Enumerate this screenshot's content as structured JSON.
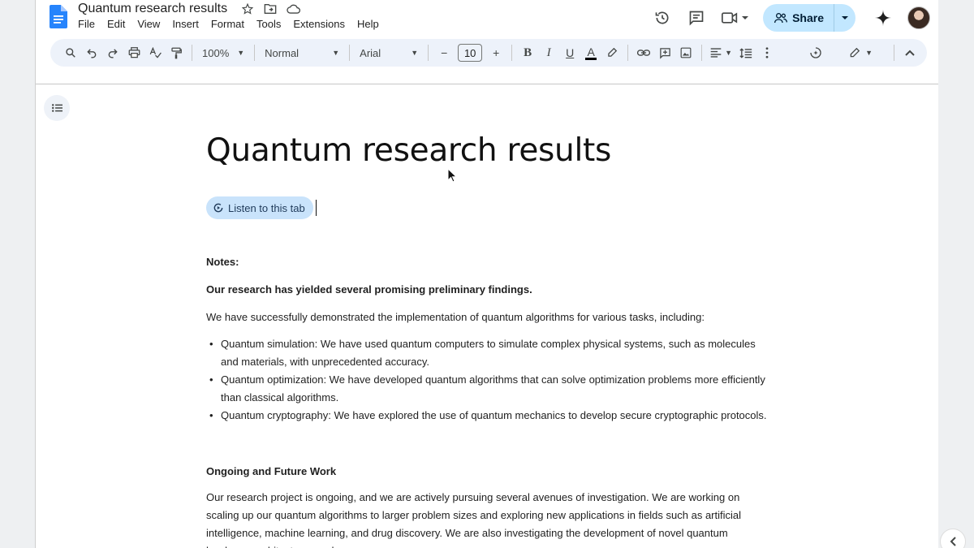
{
  "app": {
    "title": "Quantum research results",
    "menu": [
      "File",
      "Edit",
      "View",
      "Insert",
      "Format",
      "Tools",
      "Extensions",
      "Help"
    ],
    "share_label": "Share"
  },
  "toolbar": {
    "zoom": "100%",
    "style": "Normal",
    "font": "Arial",
    "font_size": "10",
    "bold": "B",
    "italic": "I",
    "underline": "U",
    "text_color": "A",
    "minus": "−",
    "plus": "+"
  },
  "document": {
    "heading": "Quantum research results",
    "listen_chip": "Listen to this tab",
    "notes_label": "Notes:",
    "summary": "Our research has yielded several promising preliminary findings.",
    "intro": "We have successfully demonstrated the implementation of quantum algorithms for various tasks, including:",
    "bullets": [
      "Quantum simulation: We have used quantum computers to simulate complex physical systems, such as molecules and materials, with unprecedented accuracy.",
      "Quantum optimization: We have developed quantum algorithms that can solve optimization problems more efficiently than classical algorithms.",
      "Quantum cryptography: We have explored the use of quantum mechanics to develop secure cryptographic protocols."
    ],
    "section_heading": "Ongoing and Future Work",
    "section_body": "Our research project is ongoing, and we are actively pursuing several avenues of investigation. We are working on scaling up our quantum algorithms to larger problem sizes and exploring new applications in fields such as artificial intelligence, machine learning, and drug discovery. We are also investigating the development of novel quantum hardware architectures and"
  },
  "colors": {
    "accent": "#c2e7ff",
    "docs_blue": "#2684fc",
    "toolbar_bg": "#edf2fa"
  }
}
